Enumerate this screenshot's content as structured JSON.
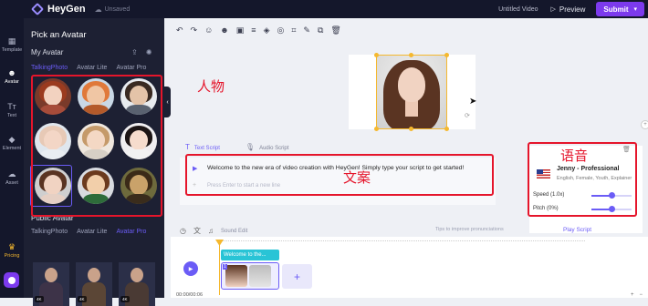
{
  "app": {
    "brand": "HeyGen",
    "save_status": "Unsaved",
    "video_title": "Untitled Video",
    "preview_label": "Preview",
    "submit_label": "Submit"
  },
  "rail": {
    "items": [
      {
        "label": "Template",
        "icon": "template-icon"
      },
      {
        "label": "Avatar",
        "icon": "avatar-icon"
      },
      {
        "label": "Text",
        "icon": "text-icon"
      },
      {
        "label": "Element",
        "icon": "element-icon"
      },
      {
        "label": "Asset",
        "icon": "asset-icon"
      },
      {
        "label": "Pricing",
        "icon": "pricing-icon"
      }
    ]
  },
  "panel": {
    "title": "Pick an Avatar",
    "my_avatar_label": "My Avatar",
    "tabs": [
      "TalkingPhoto",
      "Avatar Lite",
      "Avatar Pro"
    ],
    "public_title": "Public Avatar",
    "public_tabs": [
      "TalkingPhoto",
      "Avatar Lite",
      "Avatar Pro"
    ],
    "public_badges": [
      "4K",
      "4K",
      "4K"
    ]
  },
  "script": {
    "tab_text": "Text Script",
    "tab_audio": "Audio Script",
    "content": "Welcome to the new era of video creation with HeyGen! Simply type your script to get started!",
    "placeholder": "Press Enter to start a new line",
    "sound_effect": "Sound Edit",
    "tips": "Tips to improve pronunciations",
    "play_script": "Play Script"
  },
  "voice": {
    "name": "Jenny - Professional",
    "tags": "English, Female, Youth, Explainer",
    "speed_label": "Speed (1.0x)",
    "pitch_label": "Pitch (0%)",
    "speed_value": 0.5,
    "pitch_value": 0.5
  },
  "timeline": {
    "clip_label": "Welcome to the...",
    "clip_number": "1",
    "time": "00:00/00:06"
  },
  "annotations": {
    "avatar_label": "人物",
    "script_label": "文案",
    "voice_label": "语音",
    "color": "#e5152b"
  },
  "colors": {
    "accent": "#7c3aed",
    "dark_bg": "#14172b",
    "panel_bg": "#1d2033",
    "selection": "#f5b82e"
  }
}
